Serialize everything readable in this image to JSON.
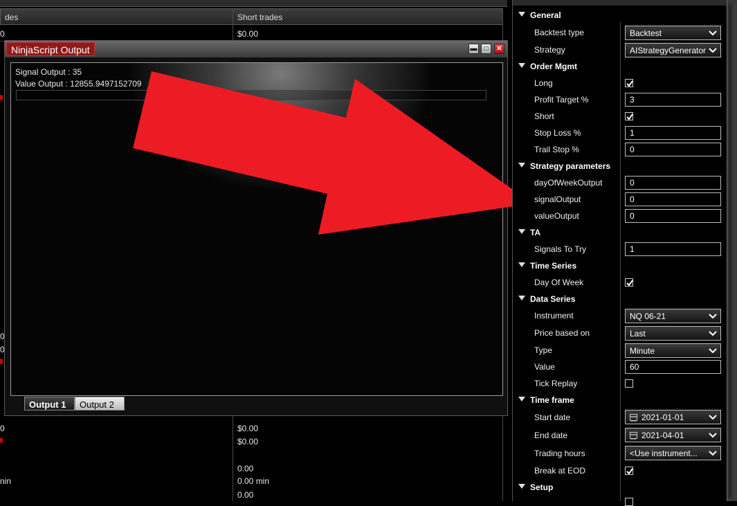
{
  "report": {
    "col_left_header": "des",
    "col_right_header": "Short trades",
    "left_cells": [
      "0",
      "0",
      "0",
      "0",
      "0",
      "nin"
    ],
    "right_cells": [
      "$0.00",
      "$0.00",
      "$0.00",
      "0.00",
      "0.00 min",
      "0.00"
    ]
  },
  "output_window": {
    "title": "NinjaScript Output",
    "lines": [
      "Signal Output : 35",
      "Value Output : 12855.9497152709"
    ],
    "tabs": [
      "Output 1",
      "Output 2"
    ],
    "active_tab": "Output 1"
  },
  "annotation": {
    "arrow_color": "#ed1c24"
  },
  "properties": {
    "general": {
      "label": "General",
      "backtest_type_label": "Backtest type",
      "backtest_type_value": "Backtest",
      "strategy_label": "Strategy",
      "strategy_value": "AIStrategyGenerator"
    },
    "order_mgmt": {
      "label": "Order Mgmt",
      "long_label": "Long",
      "long_checked": true,
      "profit_target_label": "Profit Target %",
      "profit_target_value": "3",
      "short_label": "Short",
      "short_checked": true,
      "stop_loss_label": "Stop Loss %",
      "stop_loss_value": "1",
      "trail_stop_label": "Trail Stop %",
      "trail_stop_value": "0"
    },
    "strategy_parameters": {
      "label": "Strategy parameters",
      "day_of_week_output_label": "dayOfWeekOutput",
      "day_of_week_output_value": "0",
      "signal_output_label": "signalOutput",
      "signal_output_value": "0",
      "value_output_label": "valueOutput",
      "value_output_value": "0"
    },
    "ta": {
      "label": "TA",
      "signals_to_try_label": "Signals To Try",
      "signals_to_try_value": "1"
    },
    "time_series": {
      "label": "Time Series",
      "day_of_week_label": "Day Of Week",
      "day_of_week_checked": true
    },
    "data_series": {
      "label": "Data Series",
      "instrument_label": "Instrument",
      "instrument_value": "NQ 06-21",
      "price_based_on_label": "Price based on",
      "price_based_on_value": "Last",
      "type_label": "Type",
      "type_value": "Minute",
      "value_label": "Value",
      "value_value": "60",
      "tick_replay_label": "Tick Replay",
      "tick_replay_checked": false
    },
    "time_frame": {
      "label": "Time frame",
      "start_date_label": "Start date",
      "start_date_value": "2021-01-01",
      "end_date_label": "End date",
      "end_date_value": "2021-04-01",
      "trading_hours_label": "Trading hours",
      "trading_hours_value": "<Use instrument...",
      "break_at_eod_label": "Break at EOD",
      "break_at_eod_checked": true
    },
    "setup": {
      "label": "Setup"
    }
  }
}
